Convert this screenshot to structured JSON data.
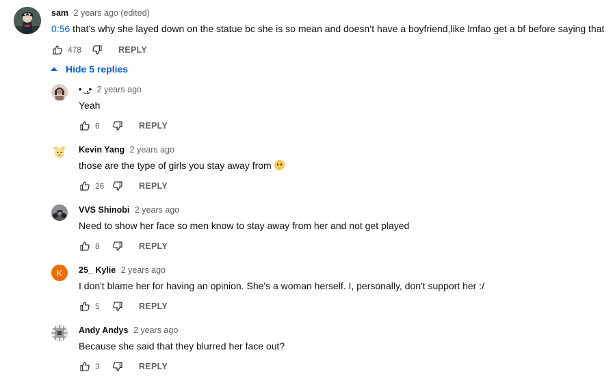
{
  "comment": {
    "author": "sam",
    "time": "2 years ago (edited)",
    "timestamp_link": "0:56",
    "text": " that’s why she layed down on the statue bc she is so mean and doesn’t have a boyfriend,like lmfao get a bf before saying that",
    "likes": "478",
    "reply_label": "REPLY"
  },
  "toggle": {
    "label": "Hide 5 replies"
  },
  "replies": [
    {
      "author": "•  ͜ ,•",
      "time": "2 years ago",
      "text": "Yeah",
      "likes": "6",
      "reply_label": "REPLY",
      "avatar": "photo-avatar"
    },
    {
      "author": "Kevin Yang",
      "time": "2 years ago",
      "text": "those are the type of girls you stay away from",
      "emoji": "grimacing-face-emoji",
      "likes": "26",
      "reply_label": "REPLY",
      "avatar": "cartoon-avatar"
    },
    {
      "author": "VVS Shinobi",
      "time": "2 years ago",
      "text": "Need to show her face so men know to stay away from her and not get played",
      "likes": "8",
      "reply_label": "REPLY",
      "avatar": "motorcycle-avatar"
    },
    {
      "author": "25_ Kylie",
      "time": "2 years ago",
      "text": "I don't blame her for having an opinion. She's a woman herself. I, personally, don't support her :/",
      "likes": "5",
      "reply_label": "REPLY",
      "avatar_letter": "K",
      "avatar_color": "#ef6c00"
    },
    {
      "author": "Andy Andys",
      "time": "2 years ago",
      "text": "Because she said that they blurred her face out?",
      "likes": "3",
      "reply_label": "REPLY",
      "avatar": "grid-avatar"
    }
  ],
  "colors": {
    "link_blue": "#065fd4",
    "secondary_text": "#606060"
  }
}
